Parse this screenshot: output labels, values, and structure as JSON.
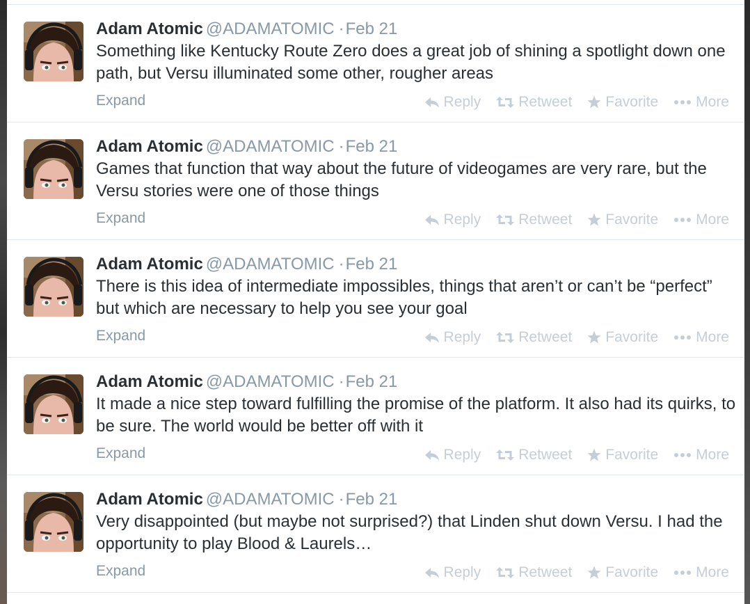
{
  "tweets": [
    {
      "fullname": "Adam Atomic",
      "username": "@ADAMATOMIC",
      "separator": "·",
      "time": "Feb 21",
      "text": "Something like Kentucky Route Zero does a great job of shining a spotlight down one path, but Versu illuminated some other, rougher areas",
      "expand": "Expand",
      "reply": "Reply",
      "retweet": "Retweet",
      "favorite": "Favorite",
      "more": "More"
    },
    {
      "fullname": "Adam Atomic",
      "username": "@ADAMATOMIC",
      "separator": "·",
      "time": "Feb 21",
      "text": "Games that function that way about the future of videogames are very rare, but the Versu stories were one of those things",
      "expand": "Expand",
      "reply": "Reply",
      "retweet": "Retweet",
      "favorite": "Favorite",
      "more": "More"
    },
    {
      "fullname": "Adam Atomic",
      "username": "@ADAMATOMIC",
      "separator": "·",
      "time": "Feb 21",
      "text": "There is this idea of intermediate impossibles, things that aren’t or can’t be “perfect” but which are necessary to help you see your goal",
      "expand": "Expand",
      "reply": "Reply",
      "retweet": "Retweet",
      "favorite": "Favorite",
      "more": "More"
    },
    {
      "fullname": "Adam Atomic",
      "username": "@ADAMATOMIC",
      "separator": "·",
      "time": "Feb 21",
      "text": "It made a nice step toward fulfilling the promise of the platform. It also had its quirks, to be sure. The world would be better off with it",
      "expand": "Expand",
      "reply": "Reply",
      "retweet": "Retweet",
      "favorite": "Favorite",
      "more": "More"
    },
    {
      "fullname": "Adam Atomic",
      "username": "@ADAMATOMIC",
      "separator": "·",
      "time": "Feb 21",
      "text": "Very disappointed (but maybe not surprised?) that Linden shut down Versu. I had the opportunity to play Blood & Laurels…",
      "expand": "Expand",
      "reply": "Reply",
      "retweet": "Retweet",
      "favorite": "Favorite",
      "more": "More"
    }
  ],
  "icons": {
    "reply": "reply-arrow-icon",
    "retweet": "retweet-icon",
    "favorite": "star-icon",
    "more": "ellipsis-icon",
    "avatar": "avatar-photo"
  },
  "colors": {
    "name": "#292f33",
    "meta": "#8899a6",
    "action": "#c5ced6",
    "divider": "#e1e8ed"
  }
}
